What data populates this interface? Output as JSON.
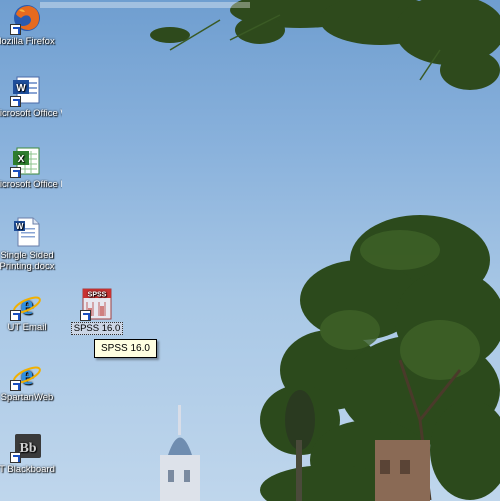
{
  "desktop": {
    "icons": [
      {
        "label": "lozilla Firefox",
        "icon": "firefox-icon"
      },
      {
        "label": "Microsoft Office W...",
        "icon": "word-icon"
      },
      {
        "label": "Microsoft Office Ex...",
        "icon": "excel-icon"
      },
      {
        "label": "Single Sided Printing.docx",
        "icon": "word-doc-icon"
      },
      {
        "label": "UT Email",
        "icon": "internet-explorer-icon"
      },
      {
        "label": "SPSS 16.0",
        "icon": "spss-icon"
      },
      {
        "label": "SpartanWeb",
        "icon": "internet-explorer-icon"
      },
      {
        "label": "T Blackboard",
        "icon": "blackboard-icon"
      }
    ],
    "tooltip": "SPSS 16.0"
  },
  "colors": {
    "sky": "#8ab2dc",
    "tree": "#2f4a1e",
    "tooltip_bg": "#ffffe1"
  }
}
